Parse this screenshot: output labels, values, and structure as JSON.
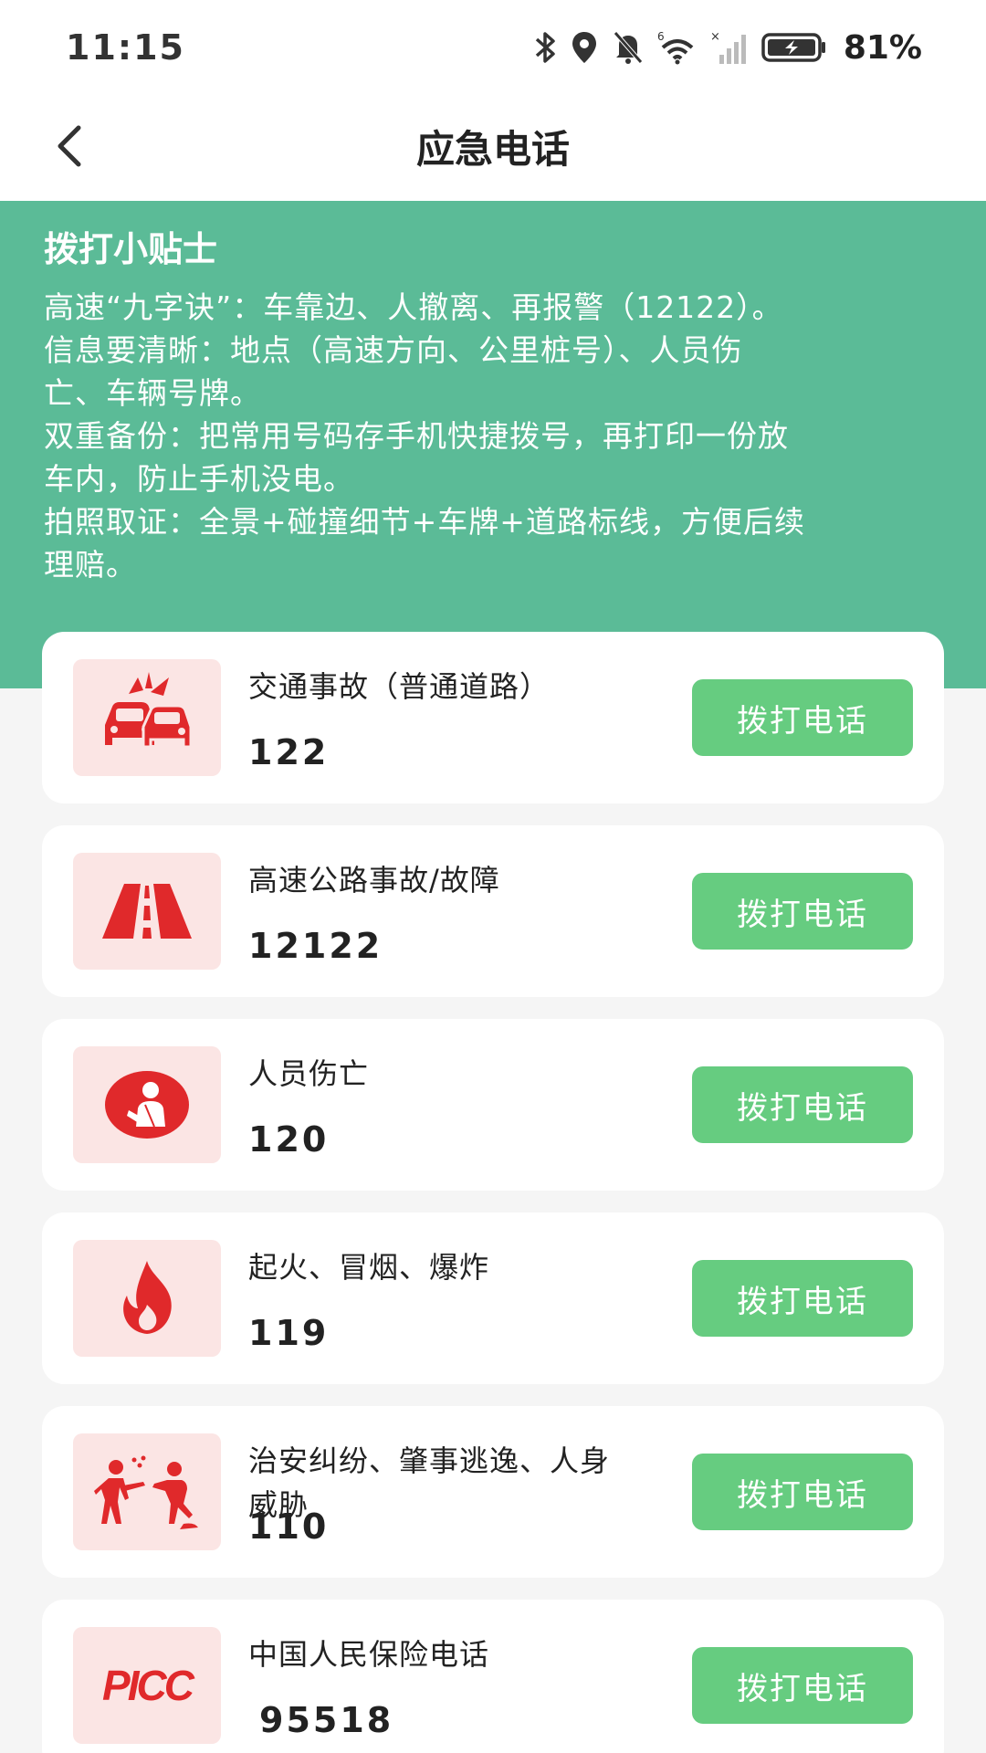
{
  "status_bar": {
    "time": "11:15",
    "battery_percent": "81%",
    "icons": [
      "bluetooth-icon",
      "location-icon",
      "mute-bell-icon",
      "wifi-icon",
      "signal-icon",
      "battery-charging-icon"
    ]
  },
  "header": {
    "title": "应急电话",
    "back_icon": "chevron-left-icon"
  },
  "tips": {
    "heading": "拨打小贴士",
    "lines": [
      "高速“九字诀”：车靠边、人撤离、再报警（12122）。",
      "信息要清晰：地点（高速方向、公里桩号）、人员伤",
      "亡、车辆号牌。",
      "双重备份：把常用号码存手机快捷拨号，再打印一份放",
      "车内，防止手机没电。",
      "拍照取证：全景+碰撞细节+车牌+道路标线，方便后续",
      "理赔。"
    ]
  },
  "contacts": [
    {
      "title": "交通事故（普通道路）",
      "number": "122",
      "icon": "car-crash-icon",
      "button": "拨打电话"
    },
    {
      "title": "高速公路事故/故障",
      "number": "12122",
      "icon": "highway-icon",
      "button": "拨打电话"
    },
    {
      "title": "人员伤亡",
      "number": "120",
      "icon": "injured-person-icon",
      "button": "拨打电话"
    },
    {
      "title": "起火、冒烟、爆炸",
      "number": "119",
      "icon": "fire-icon",
      "button": "拨打电话"
    },
    {
      "title": "治安纠纷、肇事逃逸、人身威胁",
      "number": "110",
      "icon": "fight-icon",
      "button": "拨打电话"
    },
    {
      "title": "中国人民保险电话",
      "number": "95518",
      "icon": "picc-logo",
      "logo_text": "PICC",
      "button": "拨打电话"
    }
  ],
  "colors": {
    "accent_green": "#5bbb97",
    "button_green": "#66cc80",
    "icon_red": "#e0292b",
    "icon_bg": "#fbe5e4"
  }
}
